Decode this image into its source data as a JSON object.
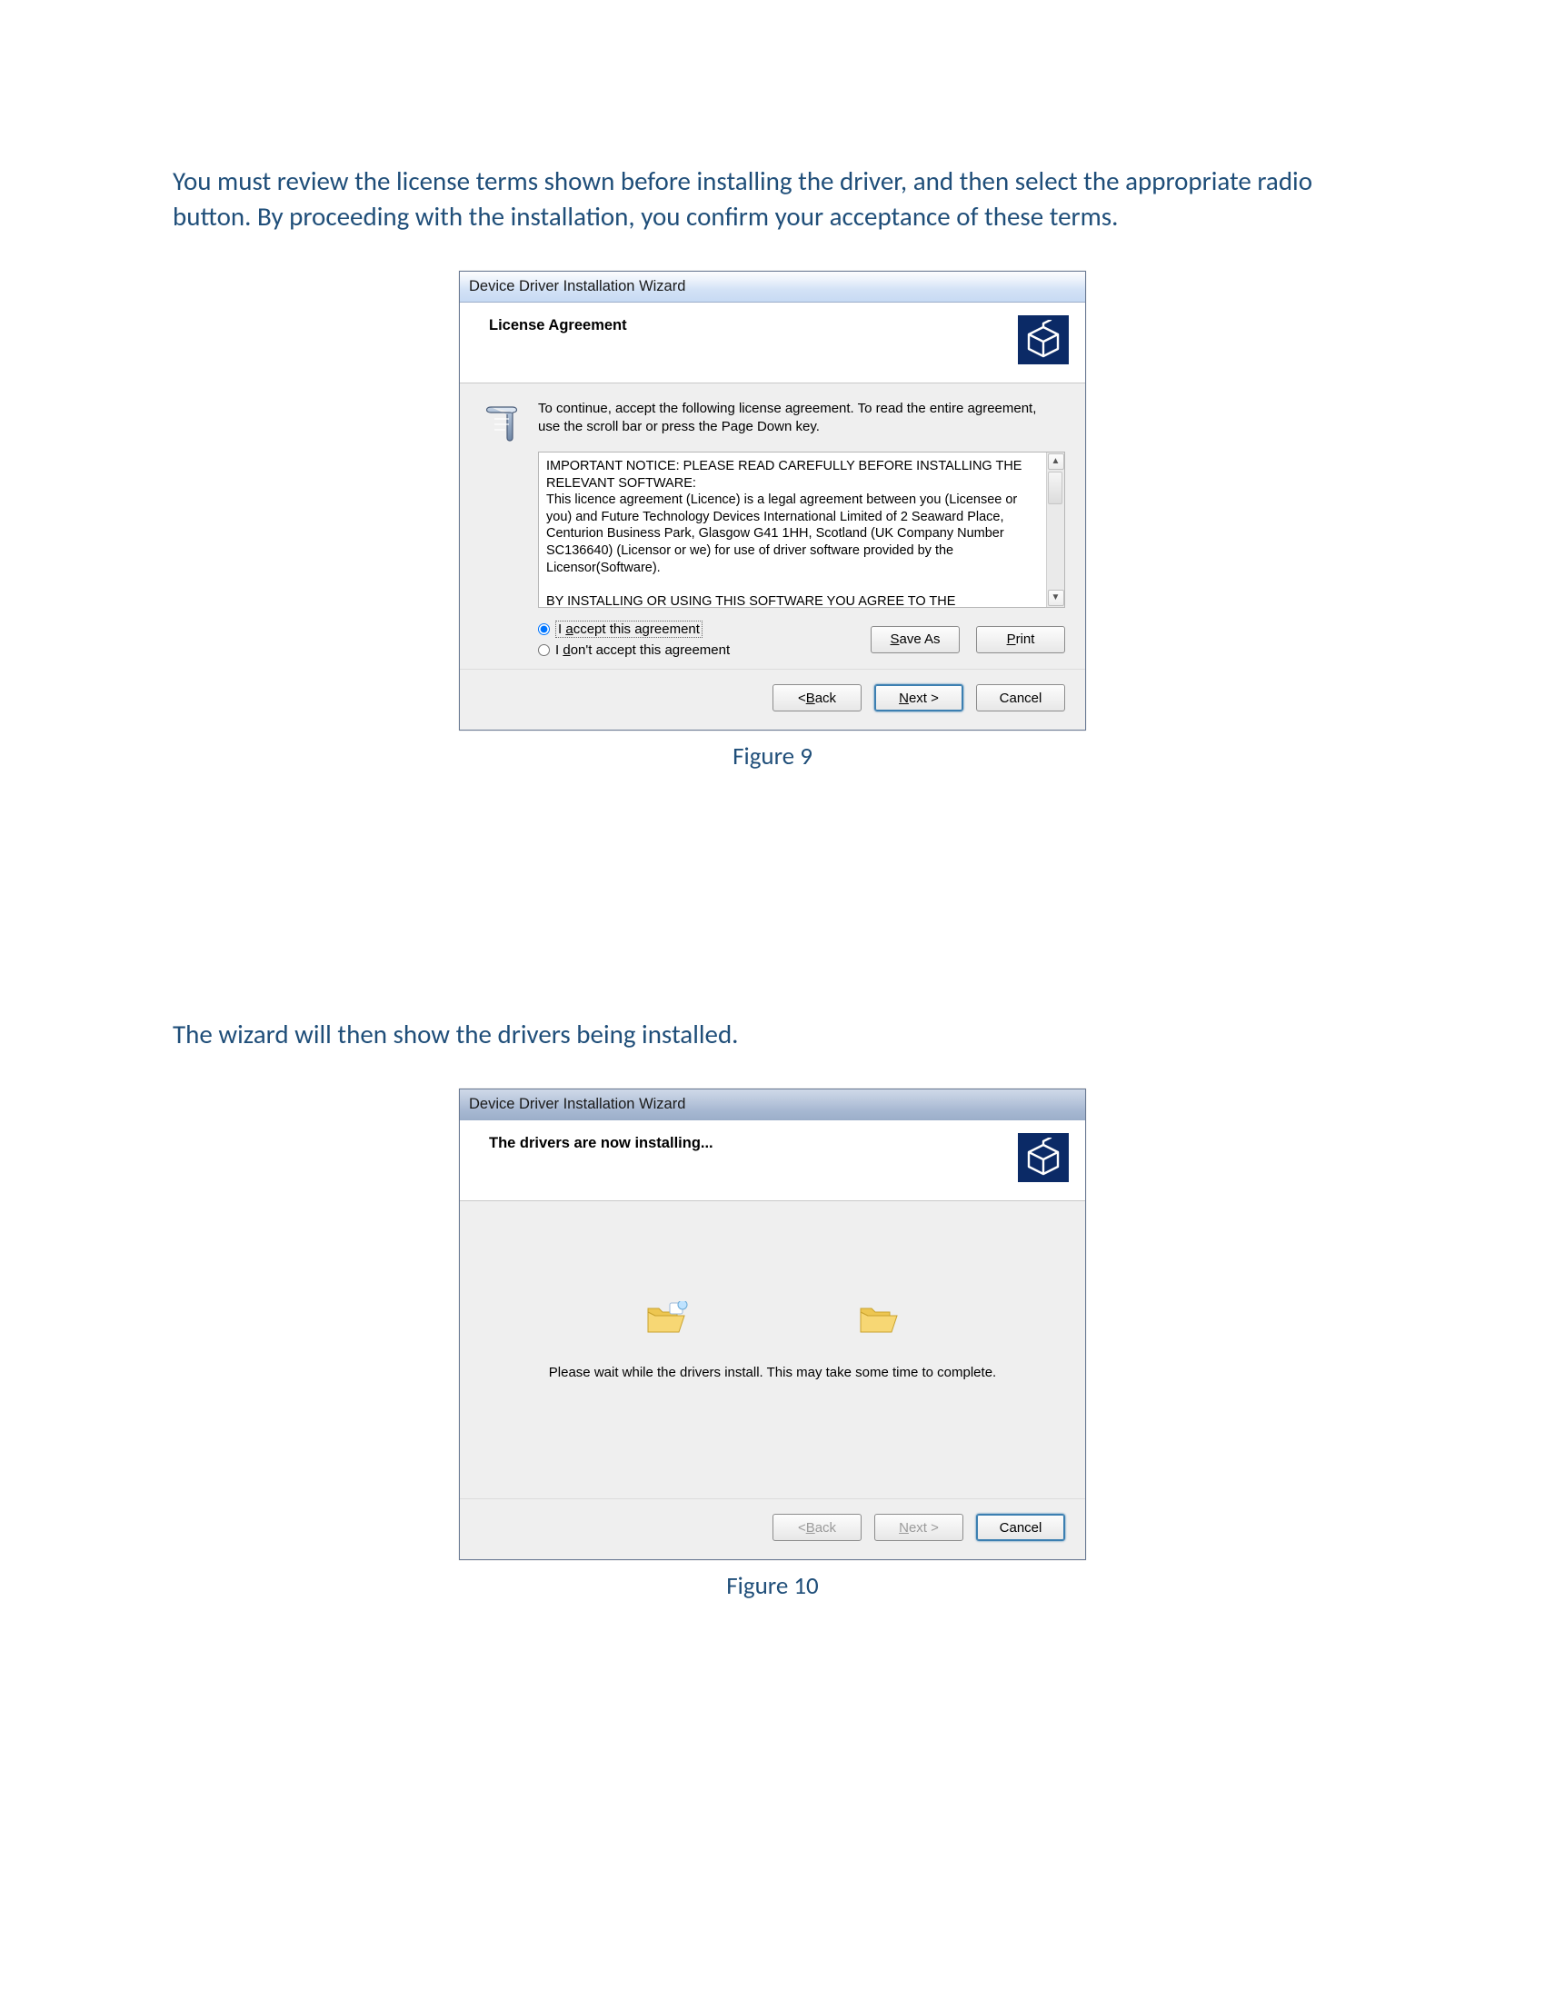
{
  "doc": {
    "para1": "You must review the license terms shown before installing the driver, and then select the appropriate radio button. By proceeding with the installation, you confirm your acceptance of these terms.",
    "caption1": "Figure 9",
    "para2": "The wizard will then show the drivers being installed.",
    "caption2": "Figure 10"
  },
  "dlg1": {
    "title": "Device Driver Installation Wizard",
    "header": "License Agreement",
    "instruction": "To continue, accept the following license agreement. To read the entire agreement, use the scroll bar or press the Page Down key.",
    "license_text": "IMPORTANT NOTICE: PLEASE READ CAREFULLY BEFORE INSTALLING THE RELEVANT SOFTWARE:\nThis licence agreement (Licence) is a legal agreement between you (Licensee or you) and Future Technology Devices International Limited of 2 Seaward Place, Centurion Business Park, Glasgow G41 1HH, Scotland (UK Company Number SC136640) (Licensor or we) for use of driver software provided by the Licensor(Software).\n\nBY INSTALLING OR USING THIS SOFTWARE YOU AGREE TO THE",
    "radios": {
      "accept_prefix": "I ",
      "accept_underline": "a",
      "accept_rest": "ccept this agreement",
      "dont_prefix": "I ",
      "dont_underline": "d",
      "dont_rest": "on't accept this agreement"
    },
    "saveas_prefix": "",
    "saveas_underline": "S",
    "saveas_rest": "ave As",
    "print_prefix": "",
    "print_underline": "P",
    "print_rest": "rint",
    "back_prefix": "< ",
    "back_underline": "B",
    "back_rest": "ack",
    "next_prefix": "",
    "next_underline": "N",
    "next_rest": "ext >",
    "cancel": "Cancel"
  },
  "dlg2": {
    "title": "Device Driver Installation Wizard",
    "header": "The drivers are now installing...",
    "wait_text": "Please wait while the drivers install. This may take some time to complete.",
    "back_prefix": "< ",
    "back_underline": "B",
    "back_rest": "ack",
    "next_prefix": "",
    "next_underline": "N",
    "next_rest": "ext >",
    "cancel": "Cancel"
  }
}
